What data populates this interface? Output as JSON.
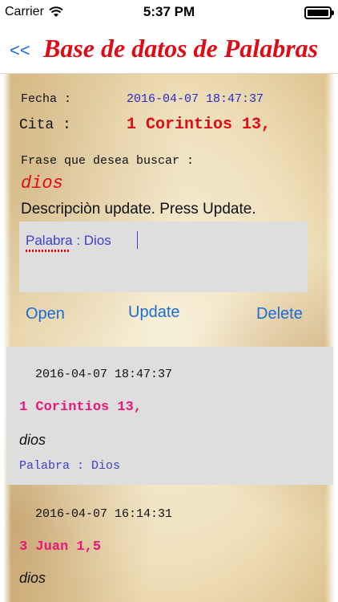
{
  "status_bar": {
    "carrier": "Carrier",
    "time": "5:37 PM",
    "battery_level": 1.0
  },
  "nav": {
    "back_label": "<<",
    "title": "Base de datos de Palabras"
  },
  "form": {
    "fecha_label": "Fecha :",
    "fecha_value": "2016-04-07 18:47:37",
    "cita_label": "Cita :",
    "cita_value": "1 Corintios 13,",
    "frase_label": "Frase que desea buscar :",
    "frase_value": "dios",
    "description": "Descripciòn update. Press Update.",
    "text_value": "Palabra : Dios"
  },
  "actions": {
    "open_label": "Open",
    "update_label": "Update",
    "delete_label": "Delete"
  },
  "entries": [
    {
      "date": "2016-04-07 18:47:37",
      "cita": "1 Corintios 13,",
      "phrase": "dios",
      "desc": "Palabra : Dios"
    },
    {
      "date": "2016-04-07 16:14:31",
      "cita": "3 Juan 1,5",
      "phrase": "dios",
      "desc": ""
    }
  ],
  "colors": {
    "accent_blue": "#1a6dd6",
    "title_red": "#e00b16",
    "cita_pink": "#e8177a",
    "date_blue": "#2a2acb"
  }
}
